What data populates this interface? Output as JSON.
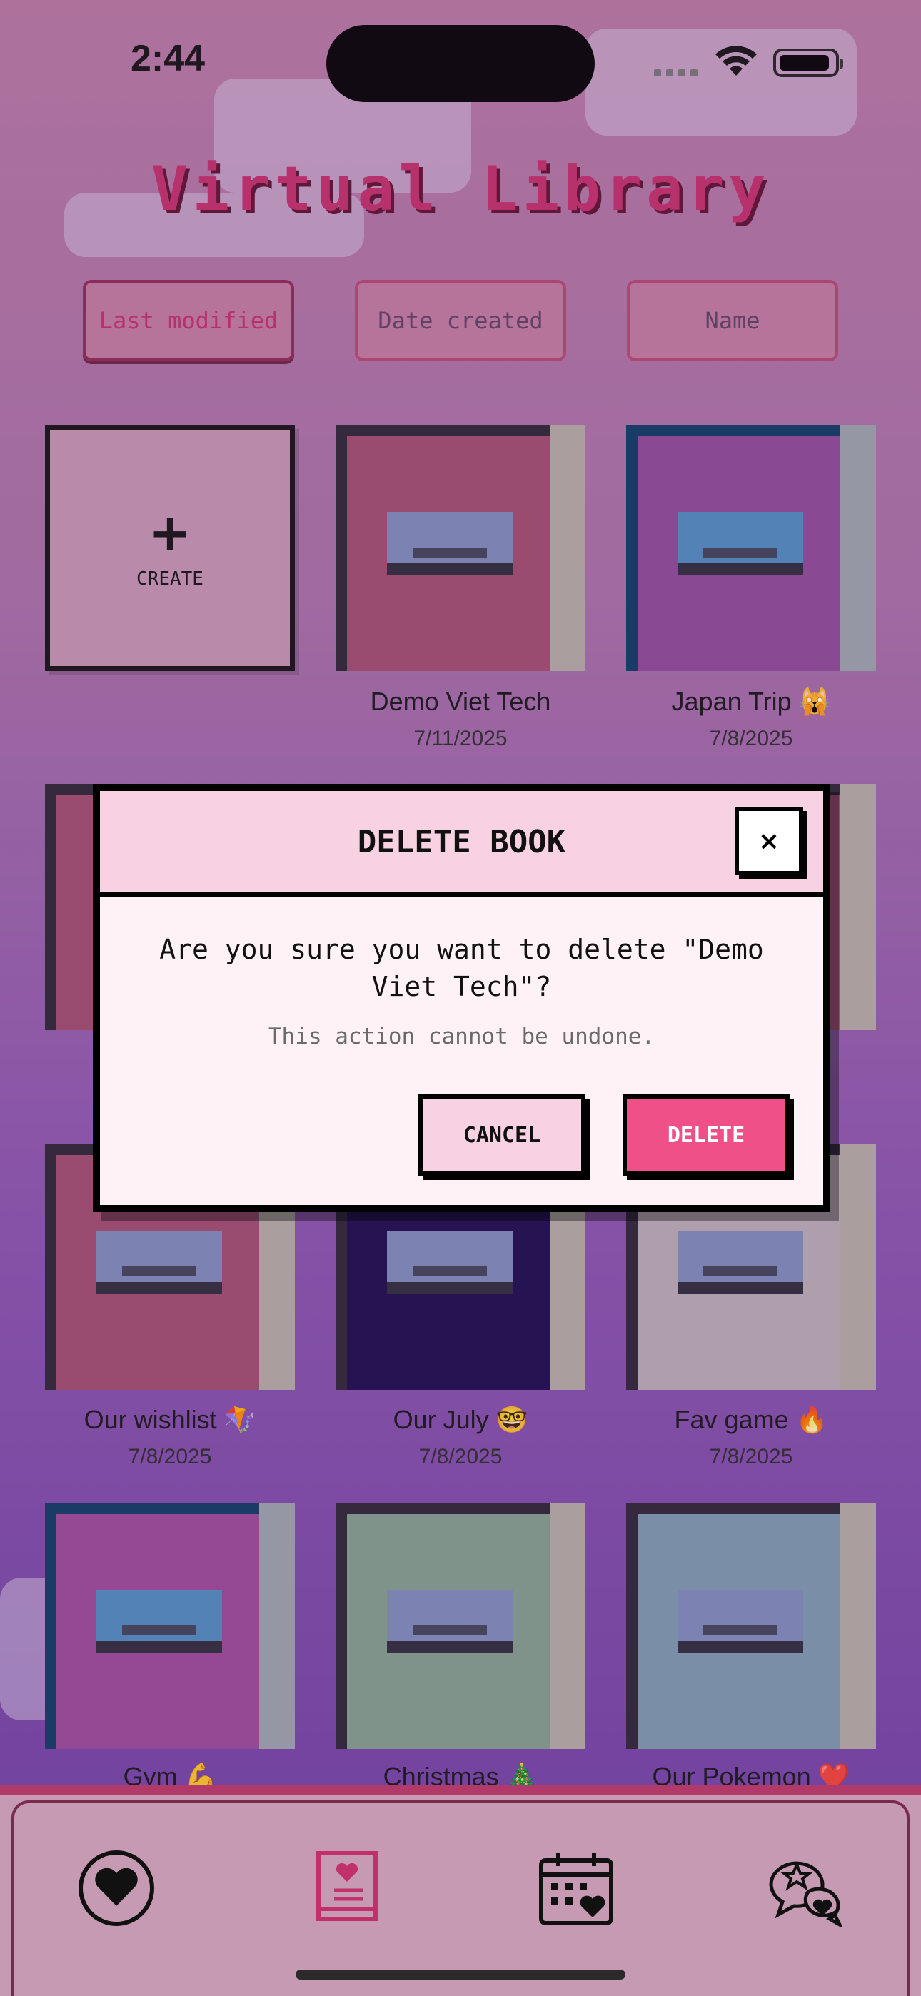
{
  "status_bar": {
    "time": "2:44"
  },
  "app": {
    "title": "Virtual Library"
  },
  "sort": {
    "options": [
      "Last modified",
      "Date created",
      "Name"
    ],
    "active": "Last modified"
  },
  "grid": {
    "create_label": "CREATE",
    "books": [
      {
        "name": "Demo Viet Tech",
        "date": "7/11/2025",
        "cover": "#9f4e6f",
        "pages": "#b3b0a5",
        "spine": "#2a2534",
        "label_tone": "#7d8fbd"
      },
      {
        "name": "Japan Trip 🙀",
        "date": "7/8/2025",
        "cover": "#8e4b98",
        "pages": "#9aa7ac",
        "spine": "#0a3a63",
        "label_tone": "#4d8ec1"
      },
      {
        "name": "Our wishlist 🪁",
        "date": "7/8/2025",
        "cover": "#9f4e6f",
        "pages": "#b3b0a5",
        "spine": "#2a2534",
        "label_tone": "#7d8fbd"
      },
      {
        "name": "Our July 🤓",
        "date": "7/8/2025",
        "cover": "#170b4c",
        "pages": "#b3b0a5",
        "spine": "#2a2534",
        "label_tone": "#7d8fbd"
      },
      {
        "name": "Fav game 🔥",
        "date": "7/8/2025",
        "cover": "#b9aeb6",
        "pages": "#b3b0a5",
        "spine": "#2a2534",
        "label_tone": "#7d8fbd"
      },
      {
        "name": "Gym 💪",
        "date": "",
        "cover": "#9a4a99",
        "pages": "#9aa7ac",
        "spine": "#0a3a63",
        "label_tone": "#4d8ec1"
      },
      {
        "name": "Christmas 🎄",
        "date": "",
        "cover": "#82a28f",
        "pages": "#b3b0a5",
        "spine": "#2a2534",
        "label_tone": "#7d8fbd"
      },
      {
        "name": "Our Pokemon ❤️",
        "date": "",
        "cover": "#7b9cb1",
        "pages": "#b3b0a5",
        "spine": "#2a2534",
        "label_tone": "#7d8fbd"
      }
    ]
  },
  "modal": {
    "title": "DELETE BOOK",
    "close_label": "×",
    "message": "Are you sure you want to delete \"Demo Viet Tech\"?",
    "subtext": "This action cannot be undone.",
    "cancel_label": "CANCEL",
    "delete_label": "DELETE",
    "accent": "#ef5088"
  },
  "nav": {
    "items": [
      {
        "icon": "heart-icon",
        "active": false
      },
      {
        "icon": "book-icon",
        "active": true
      },
      {
        "icon": "calendar-icon",
        "active": false
      },
      {
        "icon": "chat-icon",
        "active": false
      }
    ]
  }
}
